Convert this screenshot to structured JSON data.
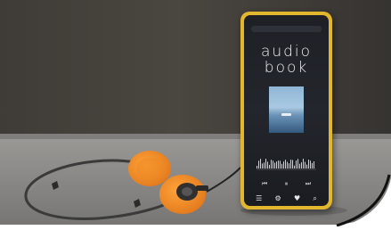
{
  "phone_screen": {
    "status_text": "",
    "url_text": "",
    "title_line1": "audio",
    "title_line2": "book",
    "track_caption": "",
    "controls": {
      "prev_icon": "skip-back-icon",
      "pause_icon": "pause-icon",
      "next_icon": "skip-forward-icon"
    },
    "nav_icons": [
      "menu-icon",
      "settings-icon",
      "heart-icon",
      "search-icon"
    ]
  },
  "colors": {
    "wall": "#45413c",
    "table": "#8a8a88",
    "phone_frame": "#e2b72e",
    "headphone_pad": "#f28a1f"
  }
}
